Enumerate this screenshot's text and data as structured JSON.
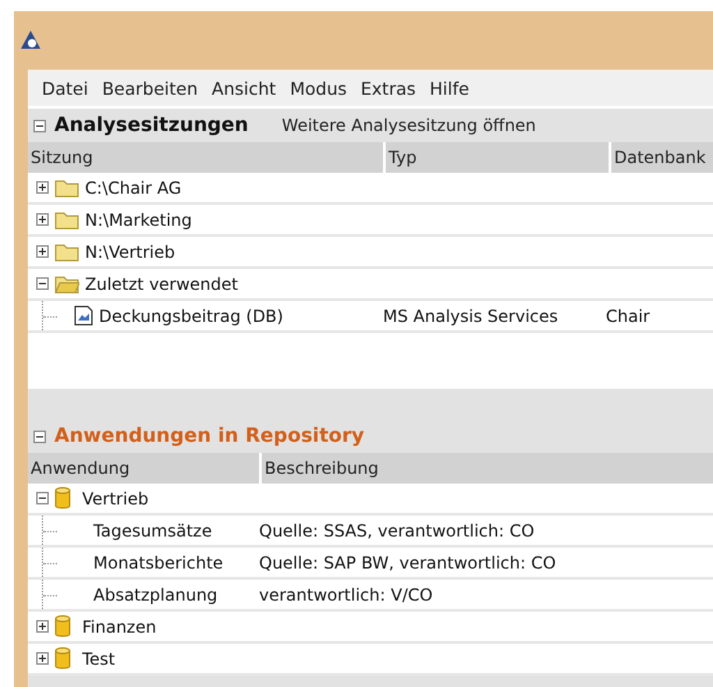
{
  "menu": [
    "Datei",
    "Bearbeiten",
    "Ansicht",
    "Modus",
    "Extras",
    "Hilfe"
  ],
  "sessions": {
    "title": "Analysesitzungen",
    "expanded": true,
    "action": "Weitere Analysesitzung öffnen",
    "columns": [
      "Sitzung",
      "Typ",
      "Datenbank"
    ],
    "rows": [
      {
        "name": "C:\\Chair AG",
        "expanded": false,
        "children": []
      },
      {
        "name": "N:\\Marketing",
        "expanded": false,
        "children": []
      },
      {
        "name": "N:\\Vertrieb",
        "expanded": false,
        "children": []
      },
      {
        "name": "Zuletzt verwendet",
        "expanded": true,
        "children": [
          {
            "name": "Deckungsbeitrag (DB)",
            "type": "MS Analysis Services",
            "database": "Chair"
          }
        ]
      }
    ]
  },
  "repository": {
    "title": "Anwendungen in Repository",
    "expanded": true,
    "columns": [
      "Anwendung",
      "Beschreibung"
    ],
    "rows": [
      {
        "name": "Vertrieb",
        "expanded": true,
        "children": [
          {
            "name": "Tagesumsätze",
            "description": "Quelle: SSAS, verantwortlich: CO"
          },
          {
            "name": "Monatsberichte",
            "description": "Quelle: SAP BW, verantwortlich: CO"
          },
          {
            "name": "Absatzplanung",
            "description": "verantwortlich: V/CO"
          }
        ]
      },
      {
        "name": "Finanzen",
        "expanded": false,
        "children": []
      },
      {
        "name": "Test",
        "expanded": false,
        "children": []
      }
    ]
  }
}
